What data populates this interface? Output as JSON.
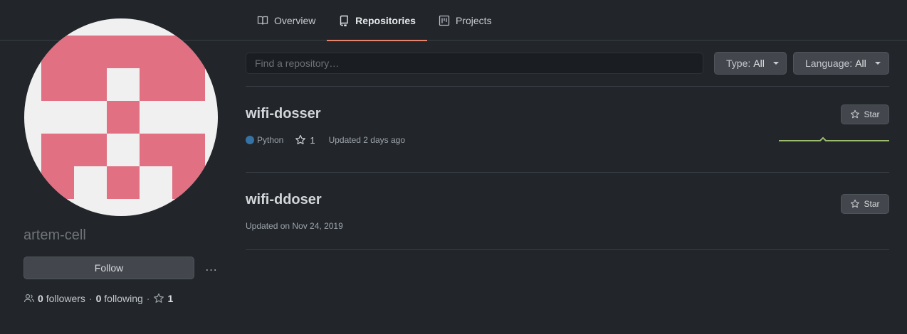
{
  "tabs": [
    {
      "label": "Overview",
      "icon": "book-icon",
      "selected": false
    },
    {
      "label": "Repositories",
      "icon": "repo-icon",
      "selected": true
    },
    {
      "label": "Projects",
      "icon": "project-icon",
      "selected": false
    }
  ],
  "profile": {
    "username": "artem-cell",
    "follow_label": "Follow",
    "more_label": "…",
    "followers_count": "0",
    "followers_label": "followers",
    "following_count": "0",
    "following_label": "following",
    "stars_count": "1",
    "separator": "·",
    "avatar_color": "#e07082"
  },
  "filters": {
    "search_placeholder": "Find a repository…",
    "type_label": "Type:",
    "type_value": "All",
    "language_label": "Language:",
    "language_value": "All"
  },
  "repos": [
    {
      "name": "wifi-dosser",
      "language": "Python",
      "language_color": "#3572a5",
      "stars": "1",
      "updated": "Updated 2 days ago",
      "star_label": "Star"
    },
    {
      "name": "wifi-ddoser",
      "updated": "Updated on Nov 24, 2019",
      "star_label": "Star"
    }
  ],
  "colors": {
    "background": "#22262b",
    "accent_underline": "#e8846b",
    "sparkline": "#9dbb6e"
  }
}
